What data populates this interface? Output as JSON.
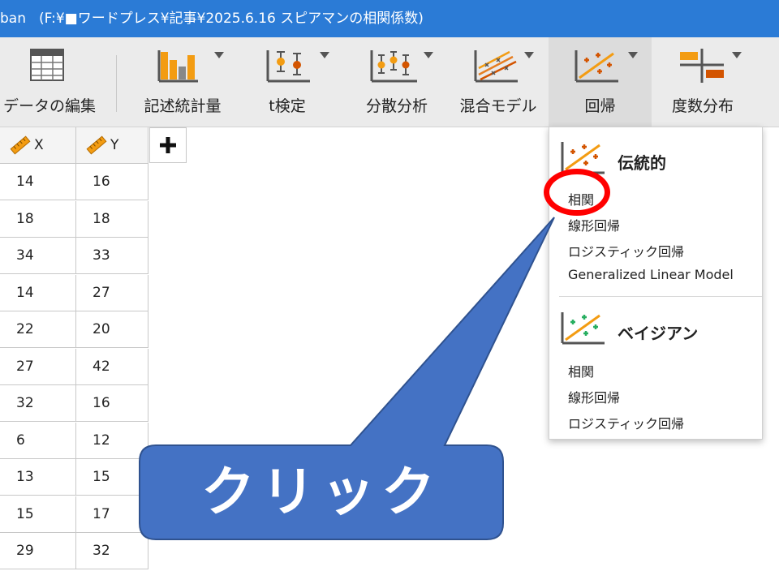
{
  "window": {
    "title_prefix": "ban",
    "title_path": "(F:¥■ワードプレス¥記事¥2025.6.16 スピアマンの相関係数)"
  },
  "toolbar": {
    "items": [
      {
        "label": "データの編集"
      },
      {
        "label": "記述統計量"
      },
      {
        "label": "t検定"
      },
      {
        "label": "分散分析"
      },
      {
        "label": "混合モデル"
      },
      {
        "label": "回帰"
      },
      {
        "label": "度数分布"
      }
    ]
  },
  "grid": {
    "columns": [
      "X",
      "Y"
    ],
    "rows": [
      [
        "14",
        "16"
      ],
      [
        "18",
        "18"
      ],
      [
        "34",
        "33"
      ],
      [
        "14",
        "27"
      ],
      [
        "22",
        "20"
      ],
      [
        "27",
        "42"
      ],
      [
        "32",
        "16"
      ],
      [
        "6",
        "12"
      ],
      [
        "13",
        "15"
      ],
      [
        "15",
        "17"
      ],
      [
        "29",
        "32"
      ]
    ]
  },
  "regression_menu": {
    "traditional": {
      "title": "伝統的",
      "items": [
        "相関",
        "線形回帰",
        "ロジスティック回帰",
        "Generalized Linear Model"
      ]
    },
    "bayesian": {
      "title": "ベイジアン",
      "items": [
        "相関",
        "線形回帰",
        "ロジスティック回帰"
      ]
    }
  },
  "annotation": {
    "callout_text": "クリック",
    "callout_color": "#4472c4",
    "circle_color": "#ff0000"
  },
  "icons": {
    "data_edit": "spreadsheet-icon",
    "descriptives": "bar-chart-icon",
    "ttest": "ttest-icon",
    "anova": "anova-icon",
    "mixed": "mixed-model-icon",
    "regression": "regression-icon",
    "frequencies": "frequencies-icon"
  },
  "colors": {
    "titlebar": "#2b7bd6",
    "toolbar_bg": "#ebebeb",
    "accent_orange": "#f39c12"
  }
}
